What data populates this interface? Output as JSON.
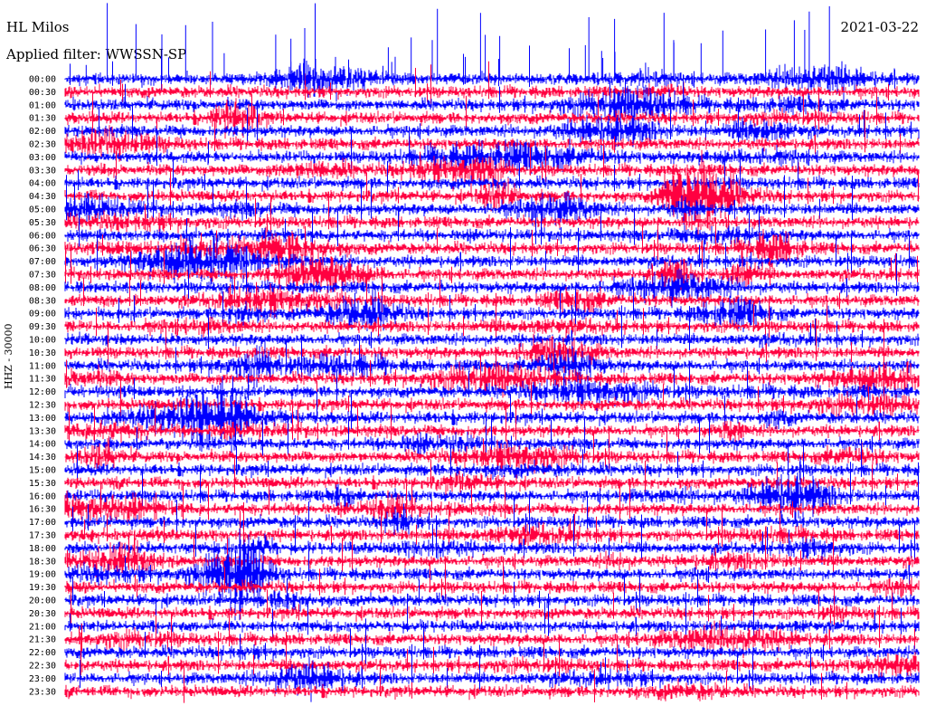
{
  "header": {
    "station": "HL Milos",
    "filter": "Applied filter: WWSSN-SP",
    "date": "2021-03-22",
    "channel": "HHZ - 30000"
  },
  "chart_data": {
    "type": "line",
    "title": "HL Milos",
    "subtitle": "Applied filter: WWSSN-SP",
    "date": "2021-03-22",
    "ylabel": "HHZ - 30000",
    "row_labels": [
      "00:00",
      "00:30",
      "01:00",
      "01:30",
      "02:00",
      "02:30",
      "03:00",
      "03:30",
      "04:00",
      "04:30",
      "05:00",
      "05:30",
      "06:00",
      "06:30",
      "07:00",
      "07:30",
      "08:00",
      "08:30",
      "09:00",
      "09:30",
      "10:00",
      "10:30",
      "11:00",
      "11:30",
      "12:00",
      "12:30",
      "13:00",
      "13:30",
      "14:00",
      "14:30",
      "15:00",
      "15:30",
      "16:00",
      "16:30",
      "17:00",
      "17:30",
      "18:00",
      "18:30",
      "19:00",
      "19:30",
      "20:00",
      "20:30",
      "21:00",
      "21:30",
      "22:00",
      "22:30",
      "23:00",
      "23:30"
    ],
    "colors": [
      "#0000ff",
      "#ff0040"
    ],
    "grid": false
  }
}
